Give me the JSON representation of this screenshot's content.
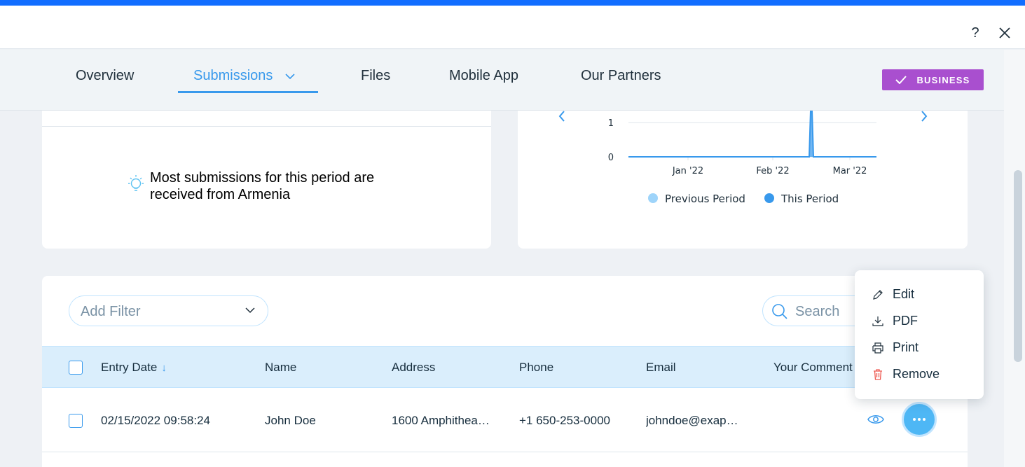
{
  "header": {
    "help_label": "?"
  },
  "nav": {
    "tabs": [
      {
        "label": "Overview"
      },
      {
        "label": "Submissions"
      },
      {
        "label": "Files"
      },
      {
        "label": "Mobile App"
      },
      {
        "label": "Our Partners"
      }
    ],
    "active_tab": "Submissions",
    "business_label": "BUSINESS",
    "business_color": "#a94fcf",
    "accent_color": "#3899ec"
  },
  "insight": {
    "icon": "lightbulb-icon",
    "text": "Most submissions for this period are received from Armenia"
  },
  "chart_data": {
    "type": "line",
    "y_ticks": [
      "1",
      "0"
    ],
    "x_ticks": [
      "Jan '22",
      "Feb '22",
      "Mar '22"
    ],
    "series": [
      {
        "name": "Previous Period",
        "color": "#9ed4fa",
        "values": []
      },
      {
        "name": "This Period",
        "color": "#3899ec",
        "spike_date": "02/15/2022",
        "spike_value": 1
      }
    ],
    "legend_position": "bottom",
    "grid": true
  },
  "table": {
    "filter_placeholder": "Add Filter",
    "search_placeholder": "Search",
    "columns": [
      "Entry Date",
      "Name",
      "Address",
      "Phone",
      "Email",
      "Your Comment"
    ],
    "sort_indicator": "↓",
    "rows": [
      {
        "entry_date": "02/15/2022 09:58:24",
        "name": "John Doe",
        "address": "1600 Amphithea…",
        "phone": "+1 650-253-0000",
        "email": "johndoe@exap…",
        "comment": ""
      }
    ]
  },
  "row_menu": {
    "items": [
      {
        "label": "Edit",
        "icon": "pencil-icon"
      },
      {
        "label": "PDF",
        "icon": "download-icon"
      },
      {
        "label": "Print",
        "icon": "printer-icon"
      },
      {
        "label": "Remove",
        "icon": "trash-icon",
        "color": "#ee5951"
      }
    ]
  }
}
